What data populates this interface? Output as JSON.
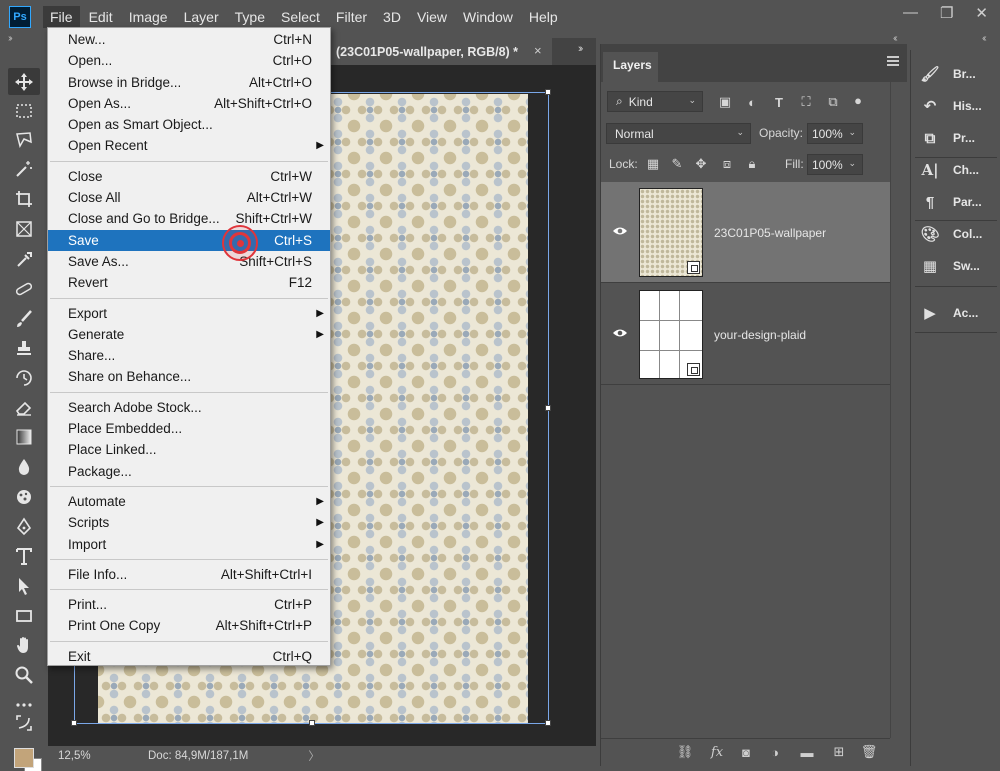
{
  "app": {
    "logo_text": "Ps"
  },
  "menubar": {
    "items": [
      "File",
      "Edit",
      "Image",
      "Layer",
      "Type",
      "Select",
      "Filter",
      "3D",
      "View",
      "Window",
      "Help"
    ],
    "active": "File"
  },
  "window_controls": {
    "minimize": "—",
    "restore": "❐",
    "close": "✕"
  },
  "document": {
    "tab_title": "(23C01P05-wallpaper, RGB/8) *",
    "tab_close": "×",
    "zoom": "12,5%",
    "doc_info": "Doc: 84,9M/187,1M",
    "status_arrow": "〉"
  },
  "file_menu": {
    "groups": [
      [
        {
          "label": "New...",
          "shortcut": "Ctrl+N"
        },
        {
          "label": "Open...",
          "shortcut": "Ctrl+O"
        },
        {
          "label": "Browse in Bridge...",
          "shortcut": "Alt+Ctrl+O"
        },
        {
          "label": "Open As...",
          "shortcut": "Alt+Shift+Ctrl+O"
        },
        {
          "label": "Open as Smart Object...",
          "shortcut": ""
        },
        {
          "label": "Open Recent",
          "shortcut": "",
          "submenu": true
        }
      ],
      [
        {
          "label": "Close",
          "shortcut": "Ctrl+W"
        },
        {
          "label": "Close All",
          "shortcut": "Alt+Ctrl+W"
        },
        {
          "label": "Close and Go to Bridge...",
          "shortcut": "Shift+Ctrl+W"
        },
        {
          "label": "Save",
          "shortcut": "Ctrl+S",
          "highlighted": true
        },
        {
          "label": "Save As...",
          "shortcut": "Shift+Ctrl+S"
        },
        {
          "label": "Revert",
          "shortcut": "F12"
        }
      ],
      [
        {
          "label": "Export",
          "shortcut": "",
          "submenu": true
        },
        {
          "label": "Generate",
          "shortcut": "",
          "submenu": true
        },
        {
          "label": "Share...",
          "shortcut": ""
        },
        {
          "label": "Share on Behance...",
          "shortcut": ""
        }
      ],
      [
        {
          "label": "Search Adobe Stock...",
          "shortcut": ""
        },
        {
          "label": "Place Embedded...",
          "shortcut": ""
        },
        {
          "label": "Place Linked...",
          "shortcut": ""
        },
        {
          "label": "Package...",
          "shortcut": ""
        }
      ],
      [
        {
          "label": "Automate",
          "shortcut": "",
          "submenu": true
        },
        {
          "label": "Scripts",
          "shortcut": "",
          "submenu": true
        },
        {
          "label": "Import",
          "shortcut": "",
          "submenu": true
        }
      ],
      [
        {
          "label": "File Info...",
          "shortcut": "Alt+Shift+Ctrl+I"
        }
      ],
      [
        {
          "label": "Print...",
          "shortcut": "Ctrl+P"
        },
        {
          "label": "Print One Copy",
          "shortcut": "Alt+Shift+Ctrl+P"
        }
      ],
      [
        {
          "label": "Exit",
          "shortcut": "Ctrl+Q"
        }
      ]
    ],
    "submenu_arrow": "▶"
  },
  "layers_panel": {
    "tab": "Layers",
    "filter_kind": "Kind",
    "blend_mode": "Normal",
    "opacity_label": "Opacity:",
    "opacity_value": "100%",
    "lock_label": "Lock:",
    "fill_label": "Fill:",
    "fill_value": "100%",
    "layers": [
      {
        "name": "23C01P05-wallpaper",
        "selected": true,
        "visible": true
      },
      {
        "name": "your-design-plaid",
        "selected": false,
        "visible": true
      }
    ]
  },
  "right_dock": {
    "items": [
      {
        "label": "Br...",
        "icon": "brush-icon"
      },
      {
        "label": "His...",
        "icon": "history-icon"
      },
      {
        "label": "Pr...",
        "icon": "properties-icon"
      },
      {
        "label": "Ch...",
        "icon": "character-icon"
      },
      {
        "label": "Par...",
        "icon": "paragraph-icon"
      },
      {
        "label": "Col...",
        "icon": "color-icon"
      },
      {
        "label": "Sw...",
        "icon": "swatches-icon"
      },
      {
        "label": "Ac...",
        "icon": "actions-icon"
      }
    ]
  },
  "colors": {
    "foreground": "#c2a47a",
    "background": "#ffffff",
    "highlight": "#1e73be",
    "click_marker": "#e0353b"
  }
}
